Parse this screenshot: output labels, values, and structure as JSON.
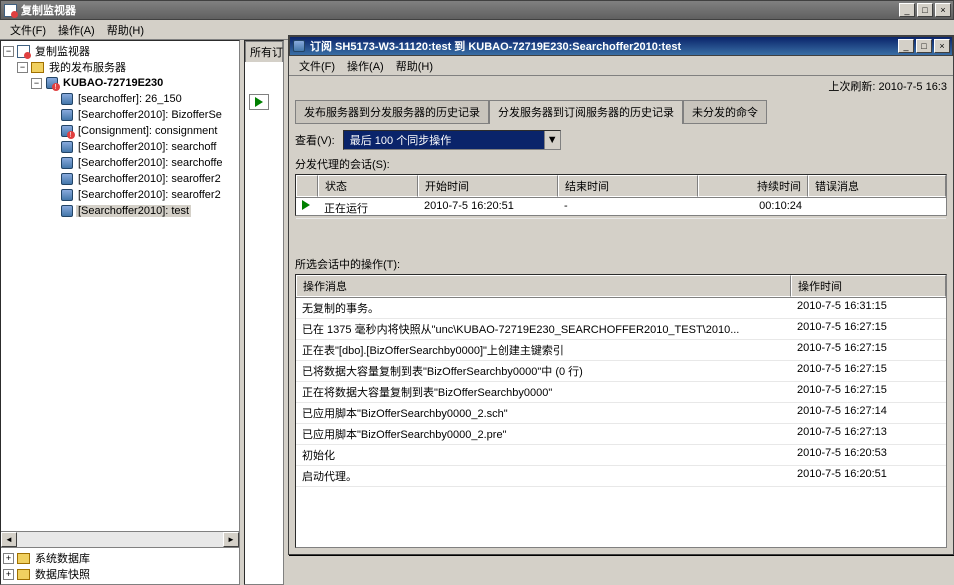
{
  "main_window": {
    "title": "复制监视器",
    "menu": {
      "file": "文件(F)",
      "action": "操作(A)",
      "help": "帮助(H)"
    },
    "winbtns": {
      "min": "_",
      "max": "□",
      "close": "×"
    }
  },
  "tree": {
    "root": "复制监视器",
    "my_pub": "我的发布服务器",
    "server": "KUBAO-72719E230",
    "items": [
      "[searchoffer]: 26_150",
      "[Searchoffer2010]: BizofferSe",
      "[Consignment]: consignment",
      "[Searchoffer2010]: searchoff",
      "[Searchoffer2010]: searchoffe",
      "[Searchoffer2010]: searoffer2",
      "[Searchoffer2010]: searoffer2",
      "[Searchoffer2010]: test"
    ]
  },
  "bottom_tree": {
    "i1": "系统数据库",
    "i2": "数据库快照"
  },
  "mid": {
    "tab": "所有订",
    "play_title": "play"
  },
  "sub_window": {
    "title": "订阅 SH5173-W3-11120:test 到 KUBAO-72719E230:Searchoffer2010:test",
    "menu": {
      "file": "文件(F)",
      "action": "操作(A)",
      "help": "帮助(H)"
    },
    "refresh": "上次刷新: 2010-7-5 16:3",
    "tabs": {
      "t1": "发布服务器到分发服务器的历史记录",
      "t2": "分发服务器到订阅服务器的历史记录",
      "t3": "未分发的命令"
    },
    "view_label": "查看(V):",
    "combo_sel": "最后 100 个同步操作",
    "combo_arrow": "▼",
    "sessions_label": "分发代理的会话(S):",
    "sess_headers": {
      "status": "状态",
      "start": "开始时间",
      "end": "结束时间",
      "dur": "持续时间",
      "err": "错误消息"
    },
    "sess_rows": [
      {
        "status": "正在运行",
        "start": "2010-7-5 16:20:51",
        "end": "-",
        "dur": "00:10:24",
        "err": ""
      }
    ],
    "ops_label": "所选会话中的操作(T):",
    "ops_headers": {
      "msg": "操作消息",
      "time": "操作时间"
    },
    "chart_data": null,
    "ops_rows": [
      {
        "msg": "无复制的事务。",
        "time": "2010-7-5 16:31:15"
      },
      {
        "msg": "已在 1375 毫秒内将快照从\"unc\\KUBAO-72719E230_SEARCHOFFER2010_TEST\\2010...",
        "time": "2010-7-5 16:27:15"
      },
      {
        "msg": "正在表\"[dbo].[BizOfferSearchby0000]\"上创建主键索引",
        "time": "2010-7-5 16:27:15"
      },
      {
        "msg": "已将数据大容量复制到表\"BizOfferSearchby0000\"中 (0 行)",
        "time": "2010-7-5 16:27:15"
      },
      {
        "msg": "正在将数据大容量复制到表\"BizOfferSearchby0000\"",
        "time": "2010-7-5 16:27:15"
      },
      {
        "msg": "已应用脚本\"BizOfferSearchby0000_2.sch\"",
        "time": "2010-7-5 16:27:14"
      },
      {
        "msg": "已应用脚本\"BizOfferSearchby0000_2.pre\"",
        "time": "2010-7-5 16:27:13"
      },
      {
        "msg": "初始化",
        "time": "2010-7-5 16:20:53"
      },
      {
        "msg": "启动代理。",
        "time": "2010-7-5 16:20:51"
      }
    ]
  }
}
